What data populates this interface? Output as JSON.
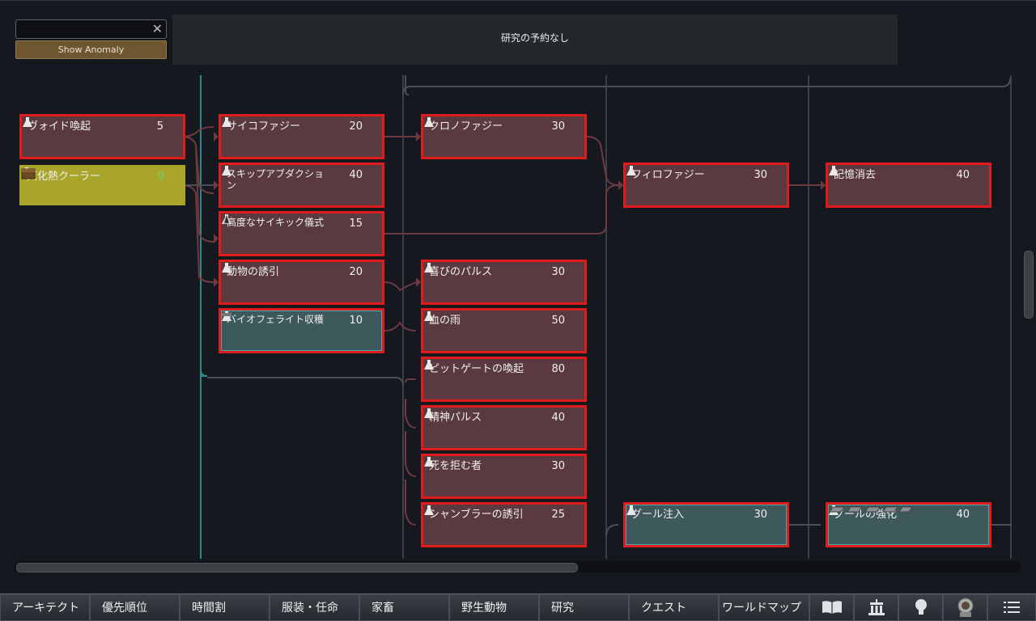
{
  "search": {
    "value": "",
    "clear_icon": "close-icon"
  },
  "anomaly_button": "Show Anomaly",
  "queue_text": "研究の予約なし",
  "colors": {
    "locked_bg": "#5a3a3f",
    "border_red": "#e01b1b",
    "done_bg": "#3e595c",
    "available_bg": "#a8a52a",
    "cost_available": "#6fd36f"
  },
  "nodes": [
    {
      "id": "void-provocation",
      "label": "ヴォイド喚起",
      "cost": "5",
      "state": "locked"
    },
    {
      "id": "vaporous-cooler",
      "label": "気化熱クーラー",
      "cost": "0",
      "state": "available",
      "icon": "chest-icon"
    },
    {
      "id": "psychophagy",
      "label": "サイコファジー",
      "cost": "20",
      "state": "locked"
    },
    {
      "id": "skip-abduction",
      "label": "スキップアブダクション",
      "cost": "40",
      "state": "locked"
    },
    {
      "id": "advanced-psychic-ritual",
      "label": "高度なサイキック儀式",
      "cost": "15",
      "state": "locked",
      "icon": "bench-icon"
    },
    {
      "id": "animal-lure",
      "label": "動物の誘引",
      "cost": "20",
      "state": "locked"
    },
    {
      "id": "biofeller-harvest",
      "label": "バイオフェライト収穫",
      "cost": "10",
      "state": "done",
      "icon": "tool-icon"
    },
    {
      "id": "chronophagy",
      "label": "クロノファジー",
      "cost": "30",
      "state": "locked"
    },
    {
      "id": "joy-pulse",
      "label": "喜びのパルス",
      "cost": "30",
      "state": "locked"
    },
    {
      "id": "blood-rain",
      "label": "血の雨",
      "cost": "50",
      "state": "locked"
    },
    {
      "id": "pit-gate",
      "label": "ピットゲートの喚起",
      "cost": "80",
      "state": "locked"
    },
    {
      "id": "mind-pulse",
      "label": "精神パルス",
      "cost": "40",
      "state": "locked"
    },
    {
      "id": "deathrefusal",
      "label": "死を拒む者",
      "cost": "30",
      "state": "locked"
    },
    {
      "id": "shambler-lure",
      "label": "シャンブラーの誘引",
      "cost": "25",
      "state": "locked"
    },
    {
      "id": "philophagy",
      "label": "フィロファジー",
      "cost": "30",
      "state": "locked"
    },
    {
      "id": "ghoul-infusion",
      "label": "グール注入",
      "cost": "30",
      "state": "done"
    },
    {
      "id": "memory-erase",
      "label": "記憶消去",
      "cost": "40",
      "state": "locked"
    },
    {
      "id": "ghoul-enhance",
      "label": "グールの強化",
      "cost": "40",
      "state": "done",
      "icon": "slabs-icon"
    }
  ],
  "bottom_bar": {
    "buttons": [
      "アーキテクト",
      "優先順位",
      "時間割",
      "服装・任命",
      "家畜",
      "野生動物",
      "研究",
      "クエスト",
      "ワールドマップ"
    ],
    "icons": [
      "book-icon",
      "history-icon",
      "lightbulb-icon",
      "portrait-icon",
      "menu-icon"
    ]
  }
}
